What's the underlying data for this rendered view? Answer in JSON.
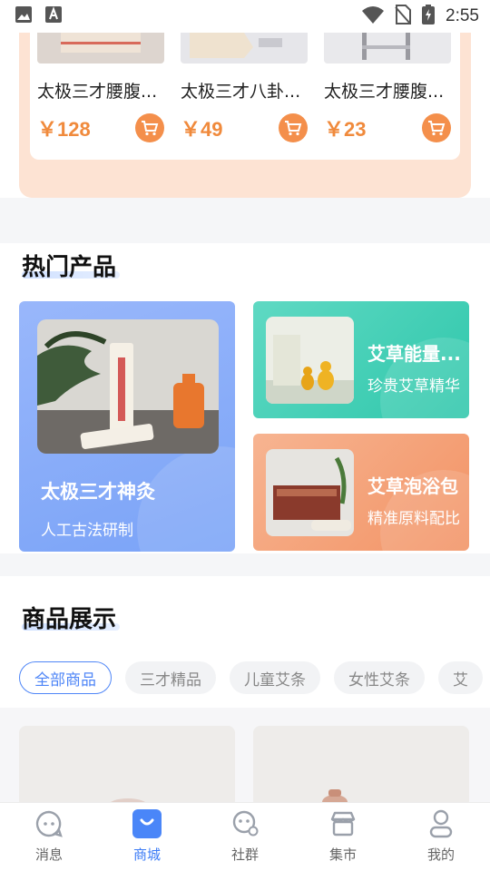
{
  "status_bar": {
    "time": "2:55"
  },
  "promo": {
    "items": [
      {
        "name": "太极三才腰腹...",
        "price": "￥128"
      },
      {
        "name": "太极三才八卦...",
        "price": "￥49"
      },
      {
        "name": "太极三才腰腹...",
        "price": "￥23"
      }
    ]
  },
  "hot": {
    "title": "热门产品",
    "big": {
      "title": "太极三才神灸",
      "subtitle": "人工古法研制"
    },
    "small": [
      {
        "title": "艾草能量...",
        "subtitle": "珍贵艾草精华"
      },
      {
        "title": "艾草泡浴包",
        "subtitle": "精准原料配比"
      }
    ]
  },
  "showcase": {
    "title": "商品展示",
    "chips": [
      "全部商品",
      "三才精品",
      "儿童艾条",
      "女性艾条",
      "艾"
    ]
  },
  "tabbar": {
    "tabs": [
      {
        "label": "消息",
        "icon": "message-icon"
      },
      {
        "label": "商城",
        "icon": "shop-icon"
      },
      {
        "label": "社群",
        "icon": "community-icon"
      },
      {
        "label": "集市",
        "icon": "market-icon"
      },
      {
        "label": "我的",
        "icon": "profile-icon"
      }
    ]
  },
  "colors": {
    "accent": "#3b7bf6",
    "price": "#f08a3c",
    "promo_bg": "#fde3d3",
    "hot_blue": "#7aa3f7",
    "hot_teal": "#3fd0b6",
    "hot_orange": "#f4a57a"
  }
}
